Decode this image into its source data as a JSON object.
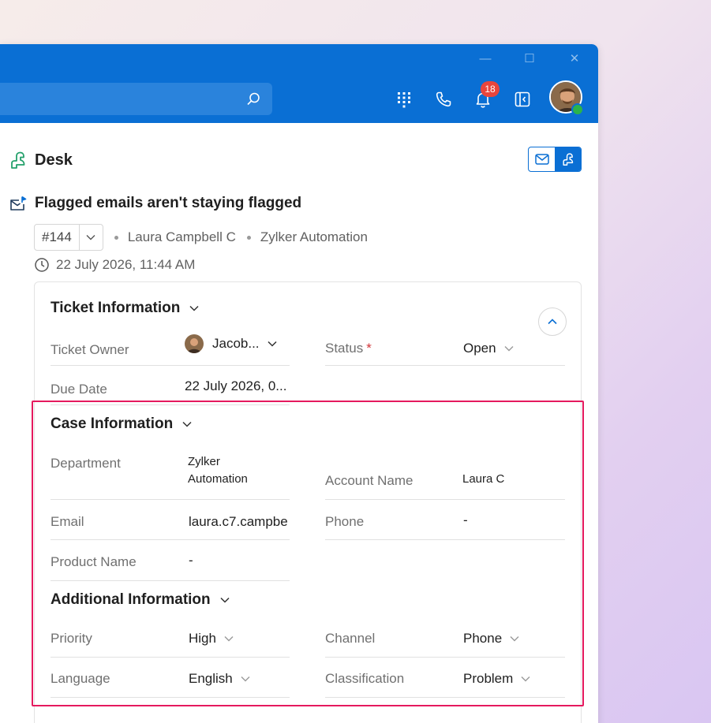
{
  "window": {
    "controls": [
      "—",
      "☐",
      "✕"
    ]
  },
  "toolbar": {
    "notification_count": "18",
    "icons": [
      "dialpad-icon",
      "phone-icon",
      "bell-icon",
      "sidebar-icon"
    ]
  },
  "desk": {
    "title": "Desk"
  },
  "ticket": {
    "subject": "Flagged emails aren't staying flagged",
    "number": "#144",
    "contact": "Laura Campbell C",
    "account": "Zylker Automation",
    "datetime": "22 July 2026, 11:44 AM"
  },
  "ticket_information": {
    "title": "Ticket Information",
    "owner_label": "Ticket Owner",
    "owner_value": "Jacob...",
    "status_label": "Status",
    "status_required": "*",
    "status_value": "Open",
    "due_label": "Due Date",
    "due_value": "22 July 2026, 0..."
  },
  "case_information": {
    "title": "Case Information",
    "department_label": "Department",
    "department_value_1": "Zylker",
    "department_value_2": "Automation",
    "account_label": "Account Name",
    "account_value": "Laura C",
    "email_label": "Email",
    "email_value": "laura.c7.campbe",
    "phone_label": "Phone",
    "phone_value": "-",
    "product_label": "Product Name",
    "product_value": "-"
  },
  "additional_information": {
    "title": "Additional Information",
    "priority_label": "Priority",
    "priority_value": "High",
    "channel_label": "Channel",
    "channel_value": "Phone",
    "language_label": "Language",
    "language_value": "English",
    "classification_label": "Classification",
    "classification_value": "Problem"
  },
  "colors": {
    "accent": "#0a6fd4",
    "highlight": "#e5195e",
    "badge": "#e8453c",
    "presence": "#2bb34a"
  }
}
